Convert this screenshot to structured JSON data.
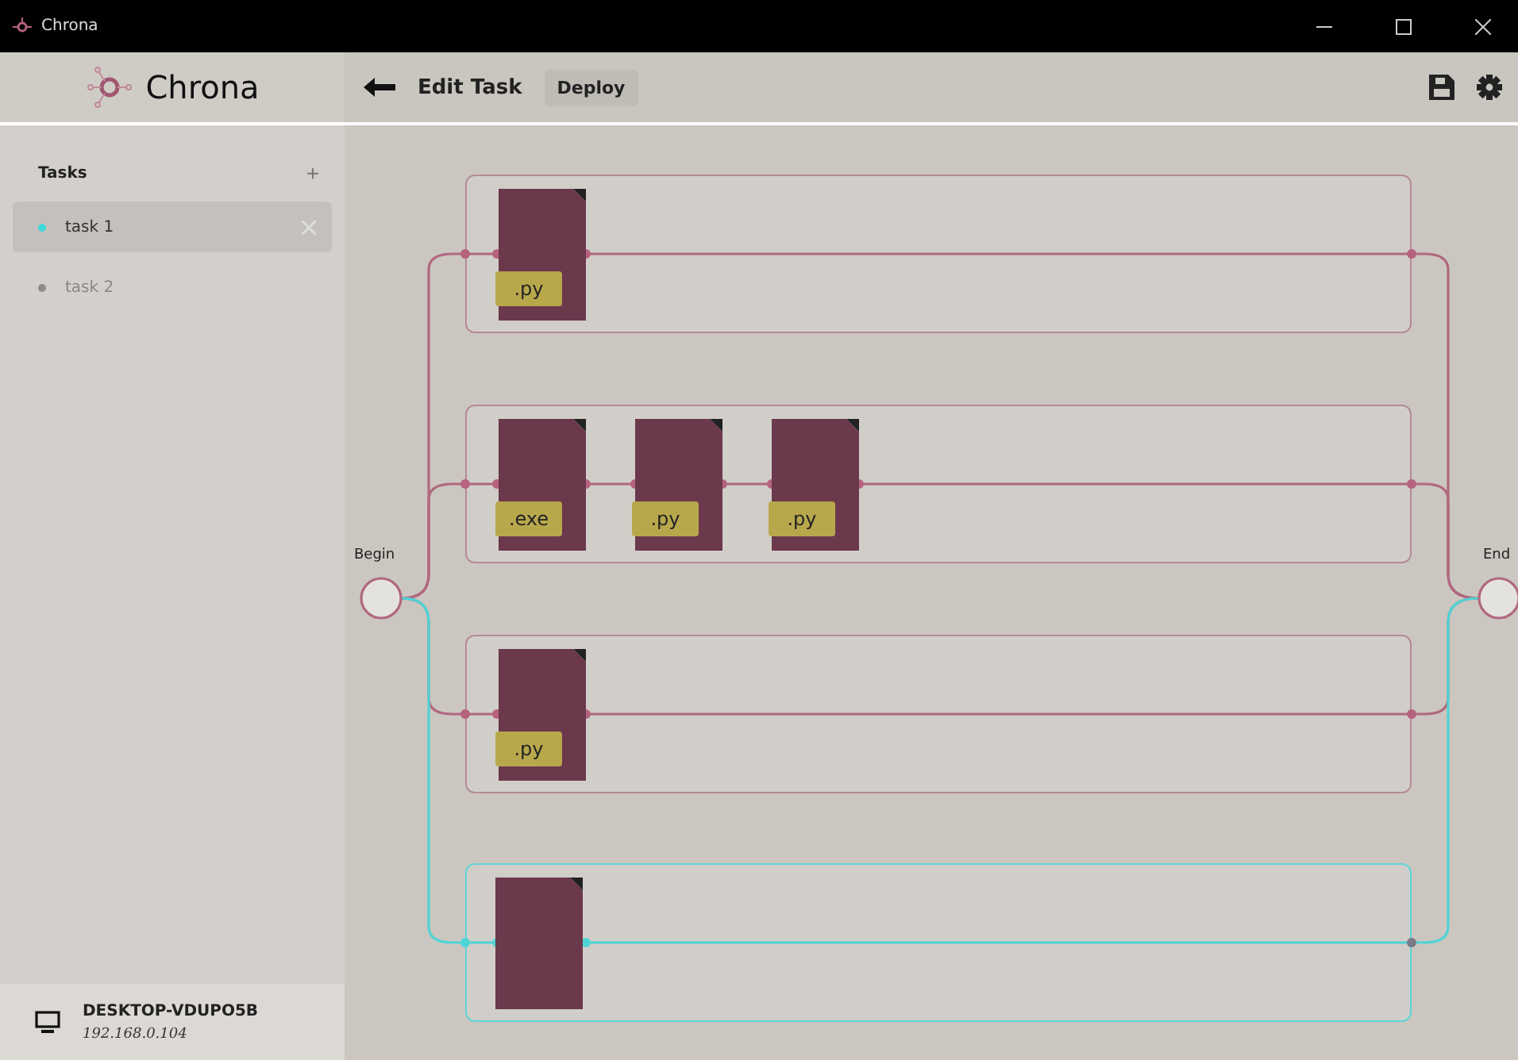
{
  "window": {
    "title": "Chrona"
  },
  "brand": {
    "name": "Chrona"
  },
  "header": {
    "title": "Edit Task",
    "deploy": "Deploy"
  },
  "sidebar": {
    "heading": "Tasks",
    "add": "+",
    "items": [
      {
        "label": "task 1",
        "selected": true,
        "color": "#3fd9dc"
      },
      {
        "label": "task 2",
        "selected": false,
        "color": "#8f8c88"
      }
    ],
    "device": {
      "name": "DESKTOP-VDUPO5B",
      "address": "192.168.0.104"
    }
  },
  "flow": {
    "begin": "Begin",
    "end": "End",
    "lanes": [
      {
        "active": false,
        "files": [
          {
            "kind": "tagged",
            "ext": ".py"
          }
        ]
      },
      {
        "active": false,
        "files": [
          {
            "kind": "tagged",
            "ext": ".exe"
          },
          {
            "kind": "tagged",
            "ext": ".py"
          },
          {
            "kind": "tagged",
            "ext": ".py"
          }
        ]
      },
      {
        "active": false,
        "files": [
          {
            "kind": "tagged",
            "ext": ".py"
          }
        ]
      },
      {
        "active": true,
        "files": [
          {
            "kind": "blank"
          }
        ]
      }
    ]
  }
}
